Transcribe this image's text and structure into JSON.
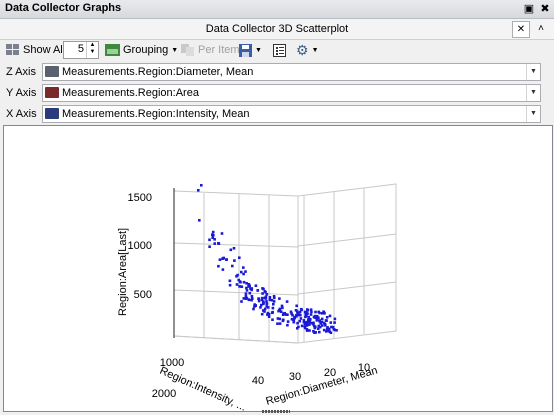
{
  "window": {
    "title": "Data Collector Graphs"
  },
  "graph_header": {
    "title": "Data Collector 3D Scatterplot"
  },
  "toolbar": {
    "show_all_label": "Show All",
    "count_value": "5",
    "grouping_label": "Grouping",
    "per_item_label": "Per Item"
  },
  "axes_selectors": {
    "z": {
      "label": "Z Axis",
      "value": "Measurements.Region:Diameter, Mean"
    },
    "y": {
      "label": "Y Axis",
      "value": "Measurements.Region:Area"
    },
    "x": {
      "label": "X Axis",
      "value": "Measurements.Region:Intensity, Mean"
    }
  },
  "chart_data": {
    "type": "scatter",
    "vertical_axis": {
      "label": "Region:Area[Last]",
      "ticks": [
        "500",
        "1000",
        "1500"
      ]
    },
    "diameter_axis": {
      "label": "Region:Diameter, Mean",
      "ticks": [
        "40",
        "30",
        "20",
        "10"
      ]
    },
    "intensity_axis": {
      "label": "Region:Intensity, ...",
      "ticks": [
        "1000",
        "2000"
      ]
    },
    "point_color": "#1a1ad6",
    "series": [
      {
        "points_approx_count": 250
      }
    ]
  }
}
